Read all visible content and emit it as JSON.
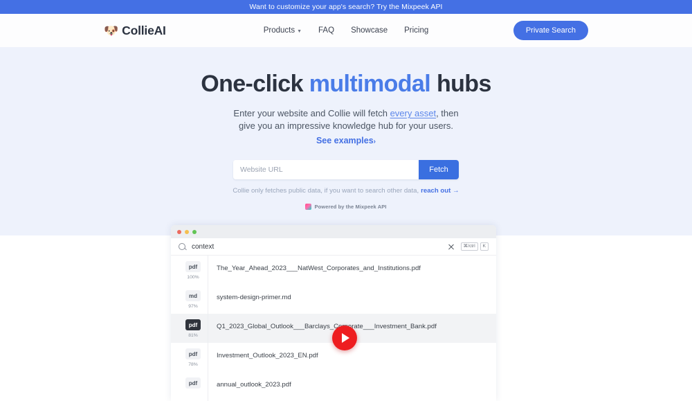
{
  "announcement": {
    "text": "Want to customize your app's search? Try the Mixpeek API",
    "bg_color": "#4470e4"
  },
  "navbar": {
    "brand": {
      "mark": "🐶",
      "name": "CollieAI"
    },
    "links": [
      {
        "label": "Products",
        "has_caret": true
      },
      {
        "label": "FAQ",
        "has_caret": false
      },
      {
        "label": "Showcase",
        "has_caret": false
      },
      {
        "label": "Pricing",
        "has_caret": false
      }
    ],
    "cta": {
      "label": "Private Search",
      "color": "#4470e4"
    }
  },
  "hero": {
    "title_part1": "One-click ",
    "title_accent": "multimodal",
    "title_part2": " hubs",
    "accent_color": "#4a7ce8",
    "subtitle_line1_a": "Enter your website and Collie will fetch ",
    "subtitle_link": "every asset",
    "subtitle_line1_b": ", then",
    "subtitle_line2": "give you an impressive knowledge hub for your users.",
    "examples_link": "See examples",
    "examples_arrow": "›",
    "form": {
      "placeholder": "Website URL",
      "value": "",
      "submit_label": "Fetch"
    },
    "note": "Collie only fetches public data, if you want to search other data,",
    "note_link": "reach out →",
    "powered_by": "Powered by the Mixpeek API",
    "powered_icon": "mixpeek-logo-icon",
    "bg_color": "#eef2fc"
  },
  "browser_mock": {
    "traffic_lights": [
      "#ec6a5e",
      "#f4bf4f",
      "#61c454"
    ],
    "search": {
      "icon": "search-icon",
      "value": "context",
      "clear_icon": "close-icon",
      "shortcut_keys": [
        "⌘/ctrl",
        "K"
      ]
    },
    "results": [
      {
        "type": "pdf",
        "score": "100%",
        "name": "The_Year_Ahead_2023___NatWest_Corporates_and_Institutions.pdf",
        "selected": false
      },
      {
        "type": "md",
        "score": "97%",
        "name": "system-design-primer.md",
        "selected": false
      },
      {
        "type": "pdf",
        "score": "81%",
        "name": "Q1_2023_Global_Outlook___Barclays_Corporate___Investment_Bank.pdf",
        "selected": true
      },
      {
        "type": "pdf",
        "score": "78%",
        "name": "Investment_Outlook_2023_EN.pdf",
        "selected": false
      },
      {
        "type": "pdf",
        "score": "",
        "name": "annual_outlook_2023.pdf",
        "selected": false
      }
    ],
    "play_button": {
      "icon": "play-icon",
      "color": "#ee1d20"
    }
  }
}
